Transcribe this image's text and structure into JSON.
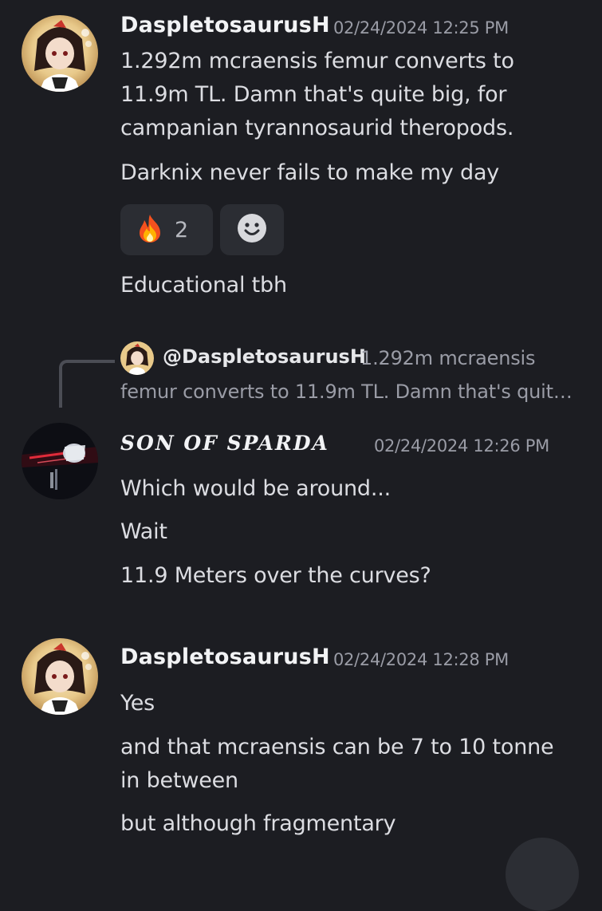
{
  "messages": [
    {
      "author": "DaspletosaurusH",
      "timestamp": "02/24/2024 12:25 PM",
      "lines": [
        "1.292m mcraensis femur converts to",
        "11.9m TL. Damn that's quite big, for",
        "campanian tyrannosaurid theropods."
      ],
      "line2": "Darknix never fails to make my day",
      "reactions": [
        {
          "emoji": "fire-icon",
          "count": "2"
        },
        {
          "emoji": "add-reaction-icon"
        }
      ],
      "line3": "Educational tbh"
    },
    {
      "reply": {
        "author": "@DaspletosaurusH",
        "preview_line1": "1.292m mcraensis",
        "preview_line2": "femur converts to 11.9m TL. Damn that's quit…"
      },
      "author": "SON OF SPARDA",
      "timestamp": "02/24/2024 12:26 PM",
      "lines": [
        "Which would be around...",
        "Wait",
        "11.9 Meters over the curves?"
      ]
    },
    {
      "author": "DaspletosaurusH",
      "timestamp": "02/24/2024 12:28 PM",
      "lines": [
        "Yes",
        "and that mcraensis can be 7 to 10 tonne",
        "in between",
        "but although fragmentary"
      ]
    }
  ],
  "colors": {
    "background": "#1c1d22",
    "author": "#f2f3f5",
    "text": "#dcdde2",
    "timestamp": "#9a9ca6",
    "reaction_bg": "#2b2d33"
  }
}
